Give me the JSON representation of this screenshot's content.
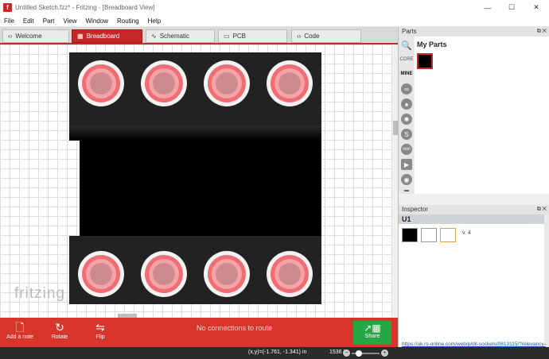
{
  "window": {
    "title": "Untitled Sketch.fzz* - Fritzing - [Breadboard View]",
    "icon_label": "f",
    "controls": [
      "—",
      "☐",
      "✕"
    ]
  },
  "menu": [
    "File",
    "Edit",
    "Part",
    "View",
    "Window",
    "Routing",
    "Help"
  ],
  "tabs": [
    {
      "label": "Welcome",
      "icon": "‹›"
    },
    {
      "label": "Breadboard",
      "icon": "▦"
    },
    {
      "label": "Schematic",
      "icon": "∿"
    },
    {
      "label": "PCB",
      "icon": "▭"
    },
    {
      "label": "Code",
      "icon": "‹›"
    }
  ],
  "canvas": {
    "watermark": "fritzing"
  },
  "toolbar": {
    "add_note": "Add a note",
    "rotate": "Rotate",
    "flip": "Flip",
    "status": "No connections to route",
    "share": "Share"
  },
  "statusbar": {
    "coords": "(x,y)=(-1.761, -1.341) in",
    "zoom": "1536 %",
    "zoom_minus": "−",
    "zoom_plus": "+"
  },
  "parts_panel": {
    "title": "Parts",
    "bins": [
      "CORE",
      "MINE"
    ],
    "bin_icons": [
      "∞",
      "♠",
      "✺",
      "S",
      "intel",
      "▶",
      "◉",
      "▬"
    ],
    "my_parts_title": "My Parts"
  },
  "inspector": {
    "title": "Inspector",
    "part_name": "U1",
    "version": "v. 4",
    "link": "https://uk.rs-online.com/web/p/dil-sockets/0813115/?relevancy-"
  },
  "colors": {
    "accent": "#c62828",
    "toolbar": "#d8362b",
    "share": "#27a644"
  }
}
